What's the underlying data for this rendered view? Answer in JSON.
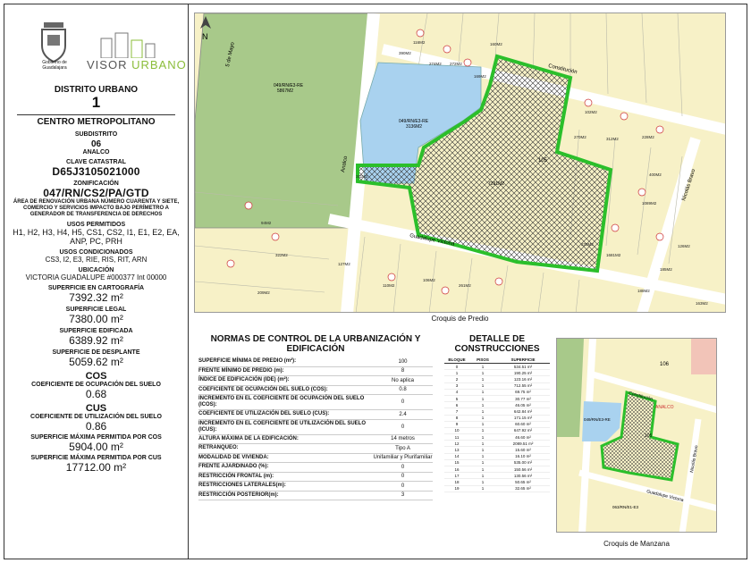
{
  "logos": {
    "municipality_caption": "Gobierno de Guadalajara",
    "app_name_a": "VISOR",
    "app_name_b": "URBANO"
  },
  "district": {
    "title": "DISTRITO URBANO",
    "number": "1",
    "name": "CENTRO METROPOLITANO",
    "subdistrict_label": "SUBDISTRITO",
    "subdistrict_number": "06",
    "subdistrict_name": "ANALCO",
    "cadastral_label": "CLAVE CATASTRAL",
    "cadastral_key": "D65J3105021000",
    "zoning_label": "ZONIFICACIÓN",
    "zoning": "047/RN/CS2/PA/GTD",
    "zoning_desc": "ÁREA DE RENOVACIÓN URBANA NÚMERO CUARENTA Y SIETE, COMERCIO Y SERVICIOS IMPACTO BAJO PERÍMETRO A GENERADOR DE TRANSFERENCIA DE DERECHOS",
    "permitted_label": "USOS PERMITIDOS",
    "permitted": "H1, H2, H3, H4, H5, CS1, CS2, I1, E1, E2, EA, ANP, PC, PRH",
    "conditioned_label": "USOS CONDICIONADOS",
    "conditioned": "CS3, I2, E3, RIE, RIS, RIT, ARN",
    "location_label": "UBICACIÓN",
    "location": "VICTORIA GUADALUPE #000377 Int 00000",
    "carto_label": "SUPERFICIE EN CARTOGRAFÍA",
    "carto_value": "7392.32 m²",
    "legal_label": "SUPERFICIE LEGAL",
    "legal_value": "7380.00 m²",
    "built_label": "SUPERFICIE EDIFICADA",
    "built_value": "6389.92 m²",
    "footprint_label": "SUPERFICIE DE DESPLANTE",
    "footprint_value": "5059.62 m²",
    "cos_abbr": "COS",
    "cos_label": "COEFICIENTE DE OCUPACIÓN DEL SUELO",
    "cos_value": "0.68",
    "cus_abbr": "CUS",
    "cus_label": "COEFICIENTE DE UTILIZACIÓN DEL SUELO",
    "cus_value": "0.86",
    "max_cos_label": "SUPERFICIE MÁXIMA PERMITIDA POR COS",
    "max_cos_value": "5904.00 m²",
    "max_cus_label": "SUPERFICIE MÁXIMA PERMITIDA POR CUS",
    "max_cus_value": "17712.00 m²"
  },
  "map_main": {
    "caption": "Croquis de Predio",
    "streets": [
      "5 de Mayo",
      "Constitución",
      "Analco",
      "Guadalupe Victoria",
      "Nicolás Bravo"
    ],
    "lot_label_a": "049/RN/E3-RE",
    "lot_area_a": "3136M2",
    "lot_label_b": "049/RN/E3-RE",
    "lot_area_b": "5867M2",
    "subject_area": "7391M2",
    "block": "105",
    "area_labels": [
      "116M2",
      "390M2",
      "274M2",
      "272M2",
      "169M2",
      "160M2",
      "102M2",
      "270M2",
      "312M2",
      "228M2",
      "400M2",
      "1089M2",
      "1681M2",
      "311M2",
      "94M2",
      "322M2",
      "209M2",
      "110M2",
      "127M2",
      "106M2",
      "261M2",
      "233M2",
      "126M2",
      "185M2",
      "188M2",
      "163M2"
    ],
    "colors": {
      "green": "#2bbf2b",
      "blue": "#a9d2ef",
      "park": "#a8c98a",
      "ground": "#f7f1c7"
    }
  },
  "map_small": {
    "caption": "Croquis de Manzana",
    "block": "106",
    "block2": "105",
    "street_a": "Constitución",
    "street_b": "ANALCO",
    "street_c": "Guadalupe Victoria",
    "street_d": "Nicolás Bravo",
    "lot_label": "049/RN/E3-RE",
    "lot_label2": "063/RN/E1-E3"
  },
  "norms": {
    "title": "NORMAS DE CONTROL DE LA URBANIZACIÓN Y EDIFICACIÓN",
    "rows": [
      {
        "k": "SUPERFICIE MÍNIMA DE PREDIO (m²):",
        "v": "100"
      },
      {
        "k": "FRENTE MÍNIMO DE PREDIO (m):",
        "v": "8"
      },
      {
        "k": "ÍNDICE DE EDIFICACIÓN (IDE) (m²):",
        "v": "No aplica"
      },
      {
        "k": "COEFICIENTE DE OCUPACIÓN DEL SUELO (COS):",
        "v": "0.8"
      },
      {
        "k": "INCREMENTO EN EL COEFICIENTE DE OCUPACIÓN DEL SUELO (ICOS):",
        "v": "0"
      },
      {
        "k": "COEFICIENTE DE UTILIZACIÓN DEL SUELO (CUS):",
        "v": "2.4"
      },
      {
        "k": "INCREMENTO EN EL COEFICIENTE DE UTILIZACIÓN DEL SUELO (ICUS):",
        "v": "0"
      },
      {
        "k": "ALTURA MÁXIMA DE LA EDIFICACIÓN:",
        "v": "14 metros"
      },
      {
        "k": "RETRANQUEO:",
        "v": "Tipo A"
      },
      {
        "k": "MODALIDAD DE VIVIENDA:",
        "v": "Unifamiliar y Plurifamiliar"
      },
      {
        "k": "FRENTE AJARDINADO (%):",
        "v": "0"
      },
      {
        "k": "RESTRICCIÓN FRONTAL (m):",
        "v": "0"
      },
      {
        "k": "RESTRICCIONES LATERALES(m):",
        "v": "0"
      },
      {
        "k": "RESTRICCIÓN POSTERIOR(m):",
        "v": "3"
      }
    ]
  },
  "constructions": {
    "title": "DETALLE DE CONSTRUCCIONES",
    "h1": "BLOQUE",
    "h2": "PISOS",
    "h3": "SUPERFICIE",
    "rows": [
      [
        "0",
        "1",
        "534.51 m²"
      ],
      [
        "1",
        "1",
        "190.25 m²"
      ],
      [
        "2",
        "1",
        "123.16 m²"
      ],
      [
        "3",
        "1",
        "712.55 m²"
      ],
      [
        "4",
        "1",
        "69.75 m²"
      ],
      [
        "5",
        "1",
        "30.77 m²"
      ],
      [
        "6",
        "1",
        "46.05 m²"
      ],
      [
        "7",
        "1",
        "642.84 m²"
      ],
      [
        "8",
        "1",
        "171.15 m²"
      ],
      [
        "9",
        "1",
        "60.60 m²"
      ],
      [
        "10",
        "1",
        "647.92 m²"
      ],
      [
        "11",
        "1",
        "46.60 m²"
      ],
      [
        "12",
        "1",
        "2089.51 m²"
      ],
      [
        "13",
        "1",
        "15.60 m²"
      ],
      [
        "14",
        "1",
        "16.10 m²"
      ],
      [
        "15",
        "1",
        "535.00 m²"
      ],
      [
        "16",
        "1",
        "150.56 m²"
      ],
      [
        "17",
        "1",
        "130.56 m²"
      ],
      [
        "18",
        "1",
        "50.65 m²"
      ],
      [
        "19",
        "1",
        "32.65 m²"
      ]
    ]
  }
}
